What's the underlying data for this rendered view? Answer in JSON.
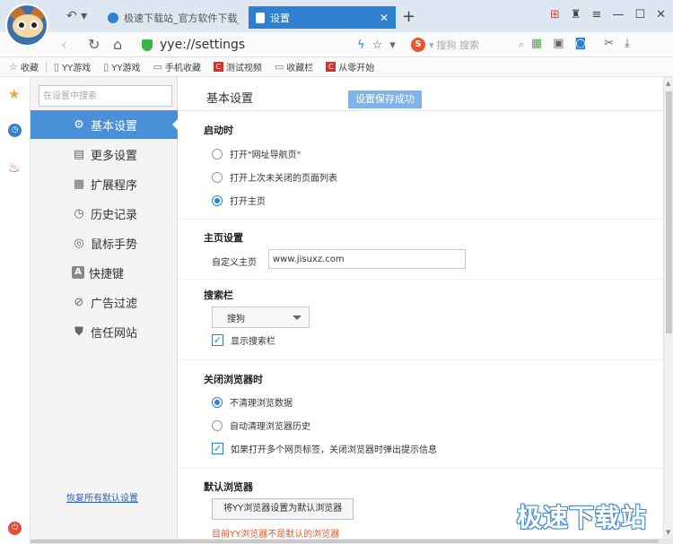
{
  "tabs": [
    {
      "title": "极速下载站_官方软件下载_k",
      "active": false
    },
    {
      "title": "设置",
      "active": true
    }
  ],
  "address": {
    "url": "yye://settings"
  },
  "search_box": {
    "engine_letter": "S",
    "placeholder": "搜狗 搜索"
  },
  "bookmarks": [
    {
      "label": "收藏",
      "icon": "star-icon"
    },
    {
      "label": "YY游戏",
      "icon": "page-icon"
    },
    {
      "label": "YY游戏",
      "icon": "page-icon"
    },
    {
      "label": "手机收藏",
      "icon": "folder-icon"
    },
    {
      "label": "测试视频",
      "icon": "c-icon"
    },
    {
      "label": "收藏栏",
      "icon": "folder-icon"
    },
    {
      "label": "从零开始",
      "icon": "c-icon"
    }
  ],
  "settings_nav": {
    "search_placeholder": "在设置中搜索",
    "items": [
      {
        "label": "基本设置",
        "icon": "gear-icon",
        "glyph": "⚙",
        "active": true
      },
      {
        "label": "更多设置",
        "icon": "list-icon",
        "glyph": "▤",
        "active": false
      },
      {
        "label": "扩展程序",
        "icon": "grid-icon",
        "glyph": "▦",
        "active": false
      },
      {
        "label": "历史记录",
        "icon": "clock-icon",
        "glyph": "◷",
        "active": false
      },
      {
        "label": "鼠标手势",
        "icon": "gesture-icon",
        "glyph": "◎",
        "active": false
      },
      {
        "label": "快捷键",
        "icon": "key-icon",
        "glyph": "A",
        "active": false
      },
      {
        "label": "广告过滤",
        "icon": "block-icon",
        "glyph": "⊘",
        "active": false
      },
      {
        "label": "信任网站",
        "icon": "shield-icon",
        "glyph": "⛊",
        "active": false
      }
    ],
    "reset_link": "恢复所有默认设置"
  },
  "main": {
    "title": "基本设置",
    "toast": "设置保存成功",
    "startup": {
      "title": "启动时",
      "options": [
        "打开\"网址导航页\"",
        "打开上次未关闭的页面列表",
        "打开主页"
      ],
      "selected": 2
    },
    "homepage": {
      "title": "主页设置",
      "label": "自定义主页",
      "value": "www.jisuxz.com"
    },
    "searchbar": {
      "title": "搜索栏",
      "selected_engine": "搜狗",
      "show_label": "显示搜索栏",
      "show_checked": true
    },
    "on_close": {
      "title": "关闭浏览器时",
      "options": [
        "不清理浏览数据",
        "自动清理浏览器历史"
      ],
      "selected": 0,
      "warn_label": "如果打开多个网页标签，关闭浏览器时弹出提示信息",
      "warn_checked": true
    },
    "default_browser": {
      "title": "默认浏览器",
      "button": "将YY浏览器设置为默认浏览器",
      "status": "目前YY浏览器不是默认的浏览器"
    }
  },
  "watermark": "极速下载站",
  "colors": {
    "accent": "#2f80d1",
    "active_nav": "#4a90d9",
    "warning": "#e05a2b"
  }
}
